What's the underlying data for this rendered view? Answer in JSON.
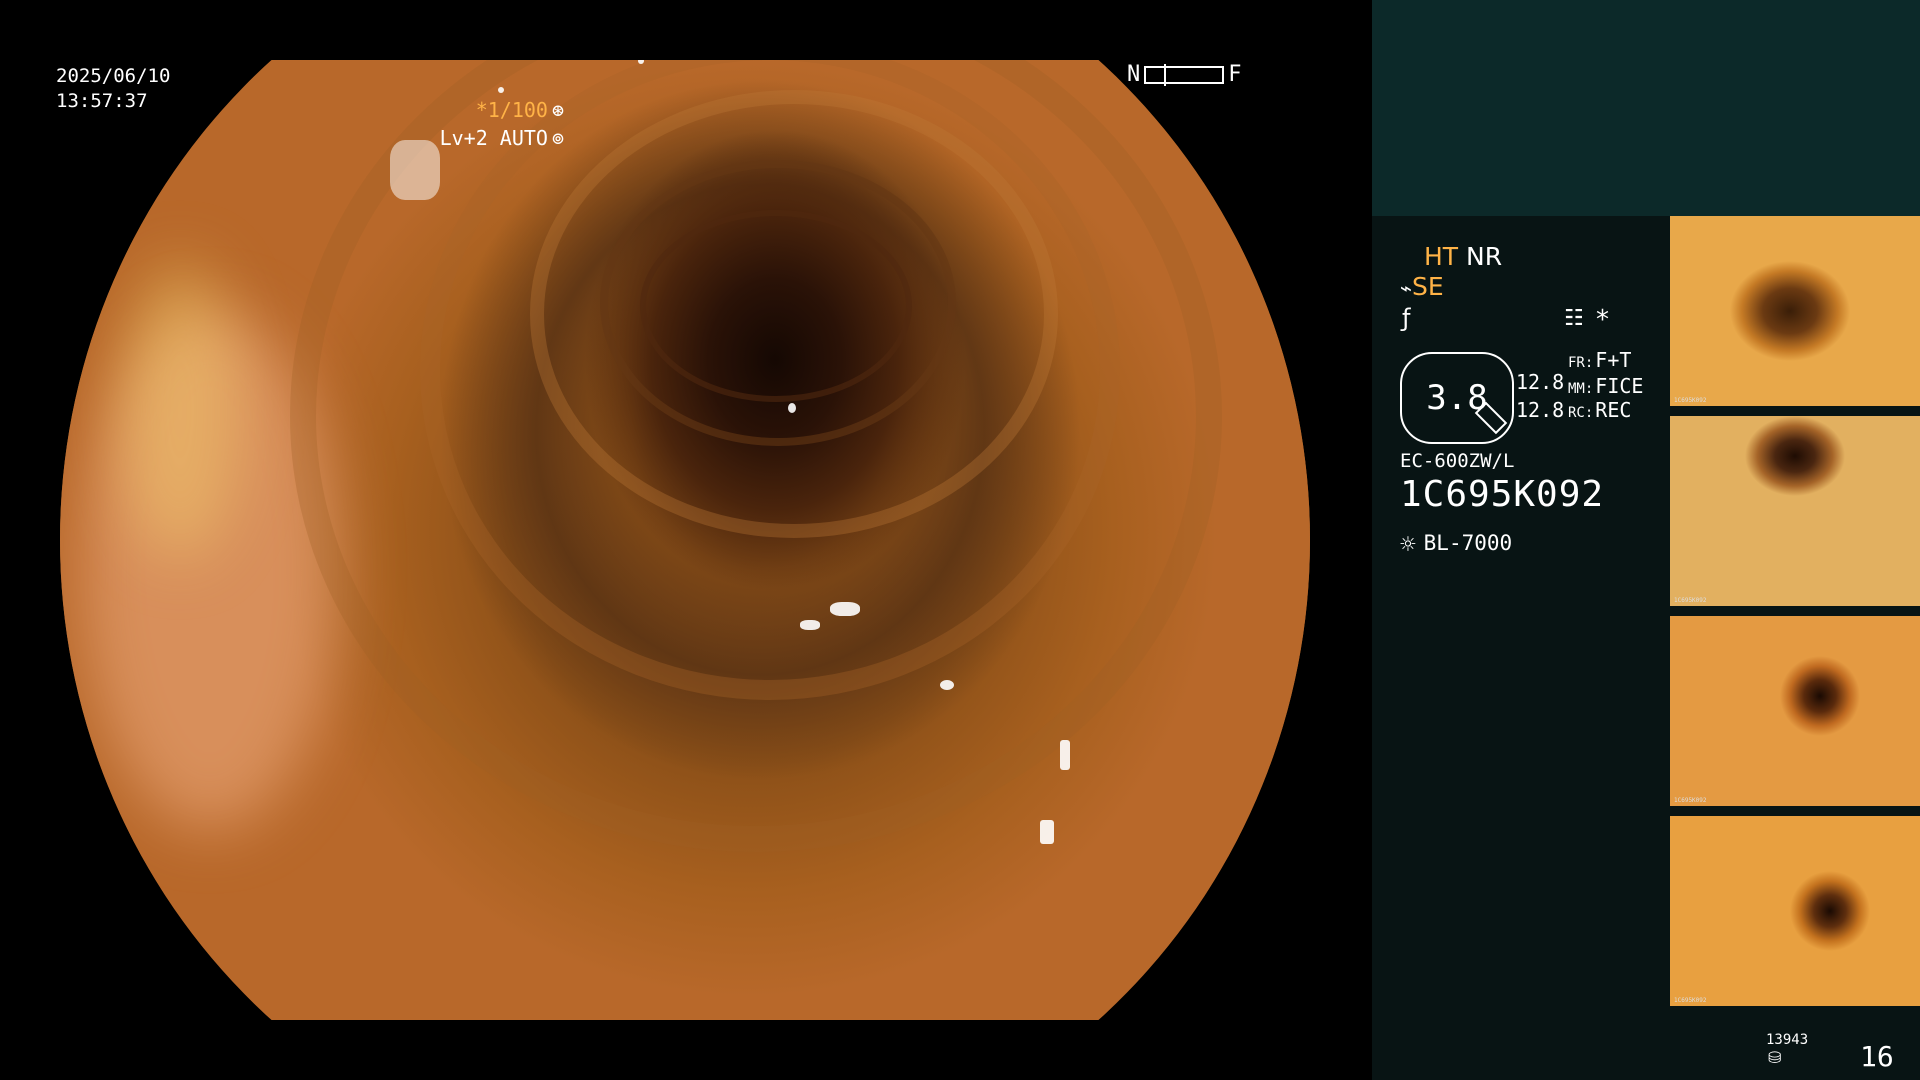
{
  "datetime": {
    "date": "2025/06/10",
    "time": "13:57:37"
  },
  "focus": {
    "near": "N",
    "far": "F"
  },
  "shutter": {
    "value": "*1/100",
    "icon": "aperture-icon"
  },
  "level": {
    "text": "Lv+2 AUTO",
    "icon": "iris-icon"
  },
  "processing": {
    "ht": "HT",
    "nr": "NR",
    "se": "SE",
    "f_icon": "f-symbol-icon",
    "menu_icon": "menu-icon",
    "star": "*"
  },
  "zoom": {
    "value": "3.8",
    "line1": "12.8",
    "line2": "12.8"
  },
  "settings": {
    "fr_key": "FR:",
    "fr_val": "F+T",
    "mm_key": "MM:",
    "mm_val": "FICE",
    "rc_key": "RC:",
    "rc_val": "REC"
  },
  "scope": {
    "model": "EC-600ZW/L",
    "serial": "1C695K092"
  },
  "light_source": {
    "name": "BL-7000",
    "icon": "light-icon"
  },
  "thumbnails": [
    {
      "caption": "1C695K092"
    },
    {
      "caption": "1C695K092"
    },
    {
      "caption": "1C695K092"
    },
    {
      "caption": "1C695K092"
    }
  ],
  "storage": {
    "count": "13943",
    "icon": "database-icon"
  },
  "image_counter": "16",
  "colors": {
    "accent": "#ffb347",
    "panel_bg": "#081414",
    "panel_top": "#0c2929"
  }
}
